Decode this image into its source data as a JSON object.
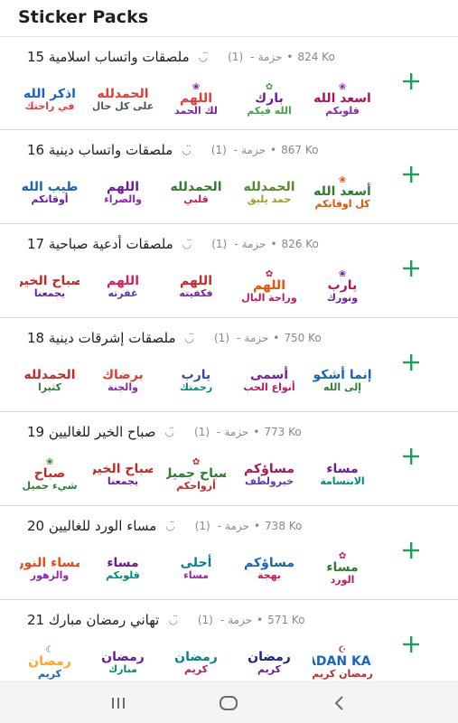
{
  "header": {
    "title": "Sticker Packs"
  },
  "pack_type_label": "حزمة",
  "bullet": "•",
  "colors": {
    "accent": "#1e9e5a",
    "meta_text": "#888888"
  },
  "packs": [
    {
      "name": "ملصقات واتساب اسلامية 15",
      "author": "◡̈",
      "count": "(1)",
      "size": "824 Ko",
      "stickers": [
        {
          "l1": "اذكر الله",
          "l2": "في راحتك",
          "c1": "#1565c0",
          "c2": "#e53935",
          "deco": ""
        },
        {
          "l1": "الحمدلله",
          "l2": "على كل حال",
          "c1": "#e53935",
          "c2": "#455a64",
          "deco": ""
        },
        {
          "l1": "اللهم",
          "l2": "لك الحمد",
          "c1": "#e53935",
          "c2": "#7b1fa2",
          "deco": "❀"
        },
        {
          "l1": "بارك",
          "l2": "الله فيكم",
          "c1": "#6a1b9a",
          "c2": "#43a047",
          "deco": "✿"
        },
        {
          "l1": "اسعد الله",
          "l2": "قلوبكم",
          "c1": "#ad1457",
          "c2": "#8e24aa",
          "deco": "❀"
        }
      ]
    },
    {
      "name": "ملصقات واتساب دينية 16",
      "author": "◡̈",
      "count": "(1)",
      "size": "867 Ko",
      "stickers": [
        {
          "l1": "طيب الله",
          "l2": "أوقاتكم",
          "c1": "#1565c0",
          "c2": "#6a1b9a",
          "deco": ""
        },
        {
          "l1": "اللهم",
          "l2": "والضراء",
          "c1": "#6a1b9a",
          "c2": "#8e24aa",
          "deco": ""
        },
        {
          "l1": "الحمدلله",
          "l2": "قلبي",
          "c1": "#2e7d32",
          "c2": "#c2185b",
          "deco": ""
        },
        {
          "l1": "الحمدلله",
          "l2": "حمد يليق",
          "c1": "#558b2f",
          "c2": "#9e9d24",
          "deco": ""
        },
        {
          "l1": "أسعد الله",
          "l2": "كل اوقاتكم",
          "c1": "#2e7d32",
          "c2": "#e65100",
          "deco": "❀"
        }
      ]
    },
    {
      "name": "ملصقات أدعية صباحية 17",
      "author": "◡̈",
      "count": "(1)",
      "size": "826 Ko",
      "stickers": [
        {
          "l1": "صباح الخير",
          "l2": "يجمعنا",
          "c1": "#c62828",
          "c2": "#6a1b9a",
          "deco": ""
        },
        {
          "l1": "اللهم",
          "l2": "غفرته",
          "c1": "#d81b60",
          "c2": "#5e35b1",
          "deco": ""
        },
        {
          "l1": "اللهم",
          "l2": "فكفيته",
          "c1": "#c62828",
          "c2": "#7b1fa2",
          "deco": ""
        },
        {
          "l1": "اللهم",
          "l2": "وراحة البال",
          "c1": "#e65100",
          "c2": "#c2185b",
          "deco": "✿"
        },
        {
          "l1": "يارب",
          "l2": "ونورك",
          "c1": "#ad1457",
          "c2": "#6a1b9a",
          "deco": "❀"
        }
      ]
    },
    {
      "name": "ملصقات إشرقات دينية 18",
      "author": "◡̈",
      "count": "(1)",
      "size": "750 Ko",
      "stickers": [
        {
          "l1": "الحمدلله",
          "l2": "كثيرا",
          "c1": "#c62828",
          "c2": "#2e7d32",
          "deco": ""
        },
        {
          "l1": "برضاك",
          "l2": "والجنة",
          "c1": "#e53935",
          "c2": "#8e24aa",
          "deco": ""
        },
        {
          "l1": "يارب",
          "l2": "رحمتك",
          "c1": "#3949ab",
          "c2": "#00897b",
          "deco": ""
        },
        {
          "l1": "أسمى",
          "l2": "أنواع الحب",
          "c1": "#7b1fa2",
          "c2": "#c2185b",
          "deco": ""
        },
        {
          "l1": "إنما أشكو",
          "l2": "إلى الله",
          "c1": "#1565c0",
          "c2": "#2e7d32",
          "deco": ""
        }
      ]
    },
    {
      "name": "صباح الخير للغاليين 19",
      "author": "◡̈",
      "count": "(1)",
      "size": "773 Ko",
      "stickers": [
        {
          "l1": "صباح",
          "l2": "شيء جميل",
          "c1": "#c62828",
          "c2": "#2e7d32",
          "deco": "❀"
        },
        {
          "l1": "صباح الخير",
          "l2": "يجمعنا",
          "c1": "#c62828",
          "c2": "#6a1b9a",
          "deco": ""
        },
        {
          "l1": "صباح جميل",
          "l2": "أرواحكم",
          "c1": "#2e7d32",
          "c2": "#c62828",
          "deco": "✿"
        },
        {
          "l1": "مساؤكم",
          "l2": "خيرولطف",
          "c1": "#ad1457",
          "c2": "#5e35b1",
          "deco": ""
        },
        {
          "l1": "مساء",
          "l2": "الابتسامة",
          "c1": "#6a1b9a",
          "c2": "#00897b",
          "deco": ""
        }
      ]
    },
    {
      "name": "مساء الورد للغاليين 20",
      "author": "◡̈",
      "count": "(1)",
      "size": "738 Ko",
      "stickers": [
        {
          "l1": "مساء النور",
          "l2": "والزهور",
          "c1": "#e64a19",
          "c2": "#8e24aa",
          "deco": ""
        },
        {
          "l1": "مساء",
          "l2": "قلوبكم",
          "c1": "#6a1b9a",
          "c2": "#00897b",
          "deco": ""
        },
        {
          "l1": "أحلى",
          "l2": "مساء",
          "c1": "#00838f",
          "c2": "#8e24aa",
          "deco": ""
        },
        {
          "l1": "مساؤكم",
          "l2": "بهجة",
          "c1": "#1565c0",
          "c2": "#c2185b",
          "deco": ""
        },
        {
          "l1": "مساء",
          "l2": "الورد",
          "c1": "#2e7d32",
          "c2": "#c2185b",
          "deco": "✿"
        }
      ]
    },
    {
      "name": "تهاني رمضان مبارك 21",
      "author": "◡̈",
      "count": "(1)",
      "size": "571 Ko",
      "stickers": [
        {
          "l1": "رمضان",
          "l2": "كريم",
          "c1": "#f9a825",
          "c2": "#1565c0",
          "deco": "☾"
        },
        {
          "l1": "رمضان",
          "l2": "مبارك",
          "c1": "#6a1b9a",
          "c2": "#00897b",
          "deco": ""
        },
        {
          "l1": "رمضان",
          "l2": "كريم",
          "c1": "#00838f",
          "c2": "#c2185b",
          "deco": ""
        },
        {
          "l1": "رمضان",
          "l2": "كريم",
          "c1": "#1a237e",
          "c2": "#6a1b9a",
          "deco": ""
        },
        {
          "l1": "RAMADAN KAREEM",
          "l2": "رمضان كريم",
          "c1": "#1565c0",
          "c2": "#c62828",
          "deco": "☪"
        }
      ]
    }
  ]
}
